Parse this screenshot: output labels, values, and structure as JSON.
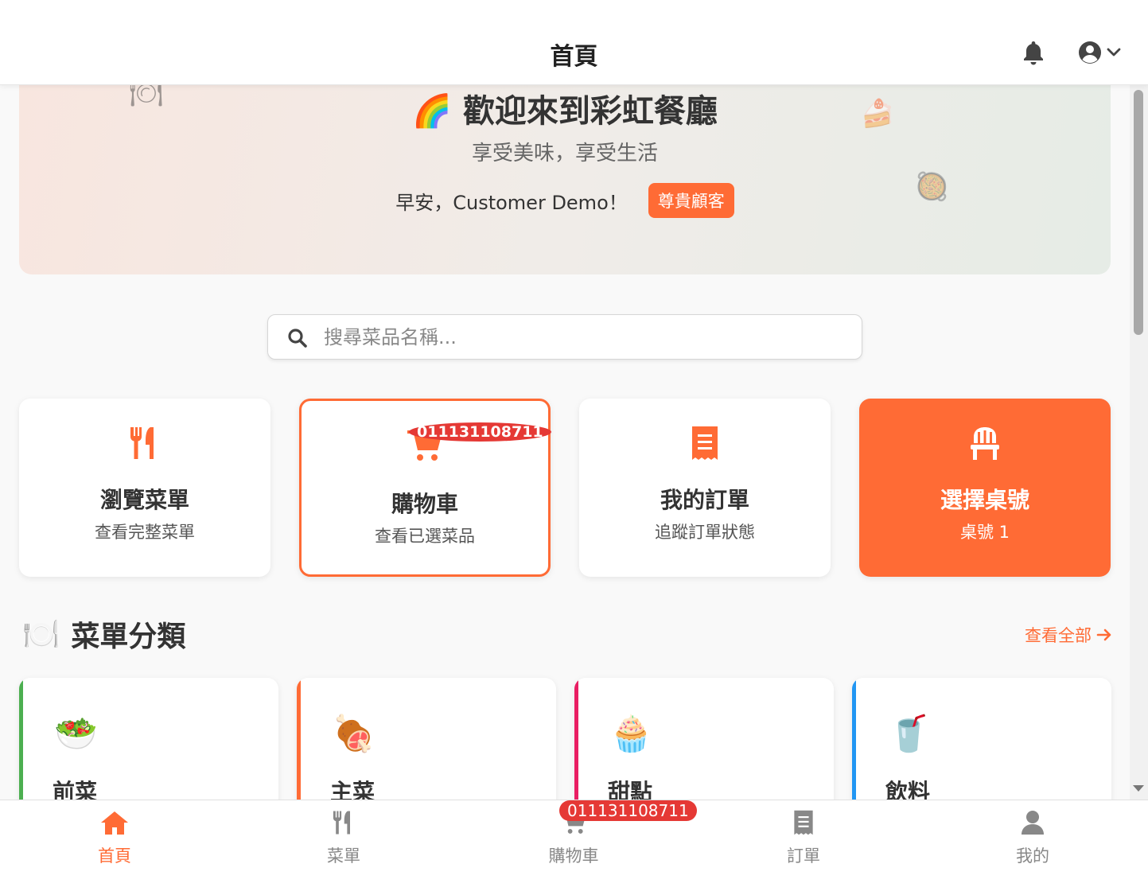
{
  "header": {
    "title": "首頁",
    "bell_icon": "bell-icon",
    "user_icon": "user-circle-icon"
  },
  "hero": {
    "emoji": "🌈",
    "title": "歡迎來到彩虹餐廳",
    "subtitle": "享受美味，享受生活",
    "greeting": "早安，Customer Demo！",
    "badge": "尊貴顧客",
    "deco_icons": [
      "🍽",
      "🍰",
      "🥘"
    ]
  },
  "search": {
    "placeholder": "搜尋菜品名稱..."
  },
  "quick_actions": [
    {
      "title": "瀏覽菜單",
      "subtitle": "查看完整菜單",
      "icon": "utensils-icon"
    },
    {
      "title": "購物車",
      "subtitle": "查看已選菜品",
      "icon": "cart-icon",
      "badge": "011131108711"
    },
    {
      "title": "我的訂單",
      "subtitle": "追蹤訂單狀態",
      "icon": "receipt-icon"
    },
    {
      "title": "選擇桌號",
      "subtitle": "桌號 1",
      "icon": "chair-icon"
    }
  ],
  "categories_section": {
    "emoji": "🍽️",
    "title": "菜單分類",
    "see_all": "查看全部"
  },
  "categories": [
    {
      "name": "前菜",
      "emoji": "🥗",
      "color": "#4caf50"
    },
    {
      "name": "主菜",
      "emoji": "🍖",
      "color": "#ff6b35"
    },
    {
      "name": "甜點",
      "emoji": "🧁",
      "color": "#e91e63"
    },
    {
      "name": "飲料",
      "emoji": "🥤",
      "color": "#2196f3"
    }
  ],
  "bottom_nav": [
    {
      "label": "首頁",
      "icon": "home-icon",
      "active": true
    },
    {
      "label": "菜單",
      "icon": "utensils-icon"
    },
    {
      "label": "購物車",
      "icon": "cart-icon",
      "badge": "011131108711"
    },
    {
      "label": "訂單",
      "icon": "receipt-icon"
    },
    {
      "label": "我的",
      "icon": "user-icon"
    }
  ],
  "colors": {
    "accent": "#ff6b35",
    "badge": "#e53935"
  }
}
